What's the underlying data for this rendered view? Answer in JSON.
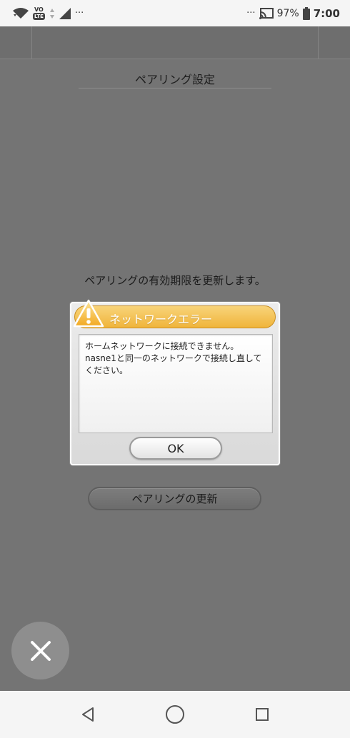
{
  "status_bar": {
    "battery": "97%",
    "time": "7:00",
    "vo_label": "VO",
    "lte_label": "LTE",
    "more_left": "···",
    "more_right": "···",
    "icons": [
      "wifi-icon",
      "volte-icon",
      "data-arrows-icon",
      "signal-icon",
      "cast-icon",
      "battery-icon"
    ]
  },
  "page": {
    "title": "ペアリング設定",
    "message": "ペアリングの有効期限を更新します。",
    "update_button": "ペアリングの更新"
  },
  "dialog": {
    "title": "ネットワークエラー",
    "body": "ホームネットワークに接続できません。nasne1と同一のネットワークで接続し直してください。",
    "ok": "OK",
    "icon": "warning-icon"
  },
  "colors": {
    "overlay_bg": "#747474",
    "dialog_header": "#f0b43a",
    "status_bar_bg": "#f5f5f5"
  },
  "nav_bar": {
    "icons": [
      "back-icon",
      "home-icon",
      "recents-icon"
    ]
  },
  "fab": {
    "icon": "close-icon"
  }
}
